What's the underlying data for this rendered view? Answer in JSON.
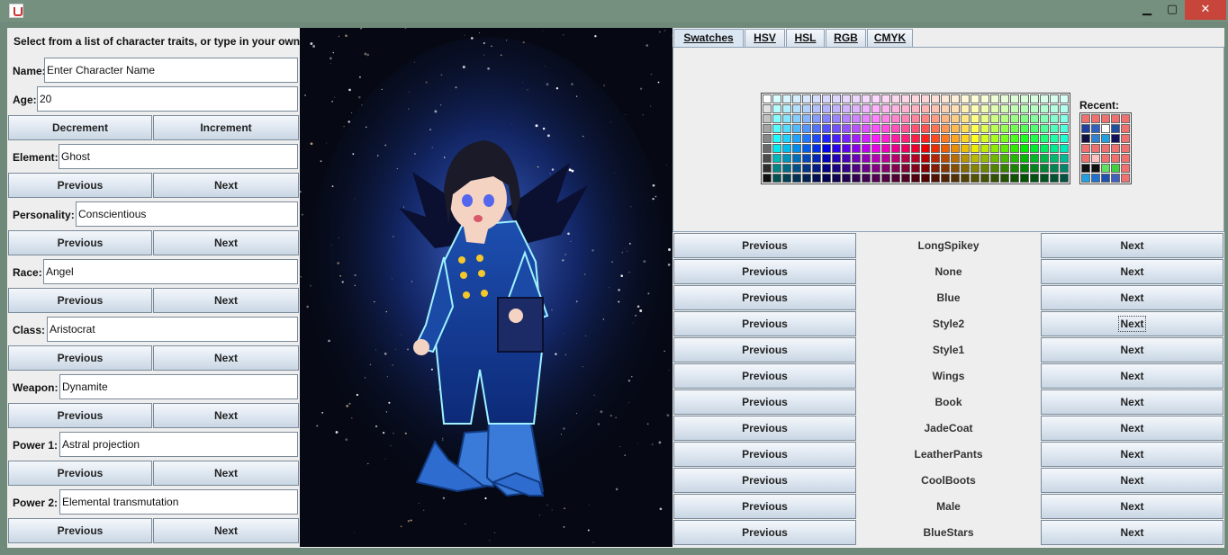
{
  "window": {
    "minimize_icon": "minimize-icon",
    "maximize_icon": "maximize-icon",
    "close_icon": "close-icon",
    "min_glyph": "▁",
    "max_glyph": "▢",
    "close_glyph": "✕"
  },
  "instructions": "Select from a list of character traits, or type in your own!",
  "name": {
    "label": "Name:",
    "value": "Enter Character Name"
  },
  "age": {
    "label": "Age:",
    "value": "20",
    "decrement": "Decrement",
    "increment": "Increment"
  },
  "traits": [
    {
      "label": "Element:",
      "value": "Ghost",
      "prev": "Previous",
      "next": "Next"
    },
    {
      "label": "Personality:",
      "value": "Conscientious",
      "prev": "Previous",
      "next": "Next"
    },
    {
      "label": "Race:",
      "value": "Angel",
      "prev": "Previous",
      "next": "Next"
    },
    {
      "label": "Class:",
      "value": "Aristocrat",
      "prev": "Previous",
      "next": "Next"
    },
    {
      "label": "Weapon:",
      "value": "Dynamite",
      "prev": "Previous",
      "next": "Next"
    },
    {
      "label": "Power 1:",
      "value": "Astral projection",
      "prev": "Previous",
      "next": "Next"
    },
    {
      "label": "Power 2:",
      "value": "Elemental transmutation",
      "prev": "Previous",
      "next": "Next"
    }
  ],
  "color_chooser": {
    "tabs": [
      "Swatches",
      "HSV",
      "HSL",
      "RGB",
      "CMYK"
    ],
    "active_tab": "Swatches",
    "recent_label": "Recent:"
  },
  "parts": [
    {
      "prev": "Previous",
      "value": "LongSpikey",
      "next": "Next"
    },
    {
      "prev": "Previous",
      "value": "None",
      "next": "Next"
    },
    {
      "prev": "Previous",
      "value": "Blue",
      "next": "Next"
    },
    {
      "prev": "Previous",
      "value": "Style2",
      "next": "Next"
    },
    {
      "prev": "Previous",
      "value": "Style1",
      "next": "Next"
    },
    {
      "prev": "Previous",
      "value": "Wings",
      "next": "Next"
    },
    {
      "prev": "Previous",
      "value": "Book",
      "next": "Next"
    },
    {
      "prev": "Previous",
      "value": "JadeCoat",
      "next": "Next"
    },
    {
      "prev": "Previous",
      "value": "LeatherPants",
      "next": "Next"
    },
    {
      "prev": "Previous",
      "value": "CoolBoots",
      "next": "Next"
    },
    {
      "prev": "Previous",
      "value": "Male",
      "next": "Next"
    },
    {
      "prev": "Previous",
      "value": "BlueStars",
      "next": "Next"
    }
  ]
}
